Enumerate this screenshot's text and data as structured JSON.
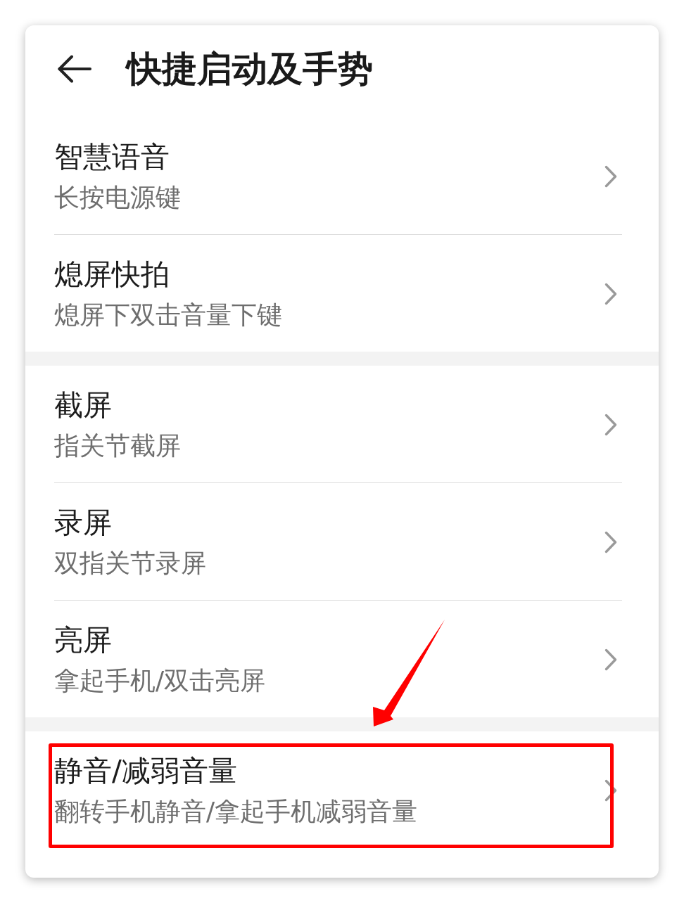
{
  "header": {
    "title": "快捷启动及手势"
  },
  "sections": [
    {
      "items": [
        {
          "title": "智慧语音",
          "subtitle": "长按电源键",
          "highlighted": false
        },
        {
          "title": "熄屏快拍",
          "subtitle": "熄屏下双击音量下键",
          "highlighted": false
        }
      ]
    },
    {
      "items": [
        {
          "title": "截屏",
          "subtitle": "指关节截屏",
          "highlighted": false
        },
        {
          "title": "录屏",
          "subtitle": "双指关节录屏",
          "highlighted": false
        },
        {
          "title": "亮屏",
          "subtitle": "拿起手机/双击亮屏",
          "highlighted": false
        }
      ]
    },
    {
      "items": [
        {
          "title": "静音/减弱音量",
          "subtitle": "翻转手机静音/拿起手机减弱音量",
          "highlighted": true
        }
      ]
    }
  ]
}
